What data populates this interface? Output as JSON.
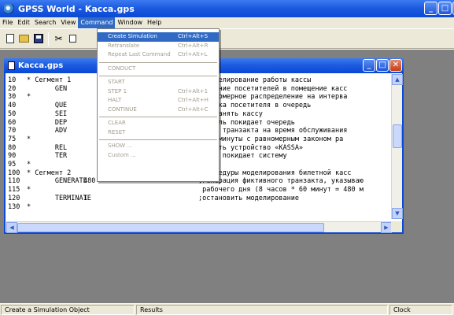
{
  "window": {
    "title": "GPSS World - Kacca.gps",
    "controls": {
      "minimize": "_",
      "maximize": "□",
      "close": "✕"
    }
  },
  "menubar": [
    "File",
    "Edit",
    "Search",
    "View",
    "Command",
    "Window",
    "Help"
  ],
  "toolbar": {
    "icons": [
      "new-doc-icon",
      "open-folder-icon",
      "save-disk-icon",
      "cut-scissors-icon",
      "copy-icon"
    ]
  },
  "command_menu": {
    "items": [
      {
        "label": "Create Simulation",
        "shortcut": "Ctrl+Alt+S",
        "state": "selected"
      },
      {
        "label": "Retranslate",
        "shortcut": "Ctrl+Alt+R",
        "state": "disabled"
      },
      {
        "label": "Repeat Last Command",
        "shortcut": "Ctrl+Alt+L",
        "state": "disabled"
      },
      {
        "separator": true
      },
      {
        "label": "CONDUCT",
        "shortcut": "",
        "state": "disabled"
      },
      {
        "separator": true
      },
      {
        "label": "START",
        "shortcut": "",
        "state": "disabled"
      },
      {
        "label": "STEP 1",
        "shortcut": "Ctrl+Alt+1",
        "state": "disabled"
      },
      {
        "label": "HALT",
        "shortcut": "Ctrl+Alt+H",
        "state": "disabled"
      },
      {
        "label": "CONTINUE",
        "shortcut": "Ctrl+Alt+C",
        "state": "disabled"
      },
      {
        "separator": true
      },
      {
        "label": "CLEAR",
        "shortcut": "",
        "state": "disabled"
      },
      {
        "label": "RESET",
        "shortcut": "",
        "state": "disabled"
      },
      {
        "separator": true
      },
      {
        "label": "SHOW ...",
        "shortcut": "",
        "state": "disabled"
      },
      {
        "label": "Custom ...",
        "shortcut": "",
        "state": "disabled"
      }
    ]
  },
  "document": {
    "title": "Kacca.gps",
    "lines": [
      {
        "no": "10",
        "c1": "* Сегмент 1",
        "c2": "",
        "c3": "",
        "cm": "е моделирование работы кассы"
      },
      {
        "no": "20",
        "c1": "       GEN",
        "c2": "",
        "c3": "",
        "cm": "тупление посетителей в помещение касс"
      },
      {
        "no": "30",
        "c1": "*",
        "c2": "",
        "c3": "",
        "cm": " равномерное распределение на интерва"
      },
      {
        "no": "40",
        "c1": "       QUE",
        "c2": "",
        "c3": "",
        "cm": "тановка посетителя в очередь"
      },
      {
        "no": "50",
        "c1": "       SEI",
        "c2": "",
        "c3": "",
        "cm": "тка занять кассу"
      },
      {
        "no": "60",
        "c1": "       DEP",
        "c2": "",
        "c3": "",
        "cm": "етитель покидает очередь"
      },
      {
        "no": "70",
        "c1": "       ADV",
        "c2": "",
        "c3": "",
        "cm": "ержка транзакта на время обслуживания"
      },
      {
        "no": "75",
        "c1": "*",
        "c2": "",
        "c3": "",
        "cm": "ы ±2 минуты с равномерным законом ра"
      },
      {
        "no": "80",
        "c1": "       REL",
        "c2": "",
        "c3": "",
        "cm": "ободить устройство «KASSA»"
      },
      {
        "no": "90",
        "c1": "       TER",
        "c2": "",
        "c3": "",
        "cm": "сажир покидает систему"
      },
      {
        "no": "95",
        "c1": "*",
        "c2": "",
        "c3": "",
        "cm": ""
      },
      {
        "no": "100",
        "c1": "* Сегмент 2",
        "c2": "",
        "c3": "",
        "cm": " процедуры моделирования билетной касс"
      },
      {
        "no": "110",
        "c1": "       GENERATE",
        "c2": "480",
        "c3": "",
        "cm": ";генерация фиктивного транзакта, указываю"
      },
      {
        "no": "115",
        "c1": "*",
        "c2": "",
        "c3": "",
        "cm": " рабочего дня (8 часов * 60 минут = 480 м"
      },
      {
        "no": "120",
        "c1": "       TERMINATE",
        "c2": "1",
        "c3": "",
        "cm": ";остановить моделирование"
      },
      {
        "no": "130",
        "c1": "*",
        "c2": "",
        "c3": "",
        "cm": ""
      }
    ]
  },
  "statusbar": {
    "left": "Create a Simulation Object",
    "middle": "Results",
    "right": "Clock"
  }
}
